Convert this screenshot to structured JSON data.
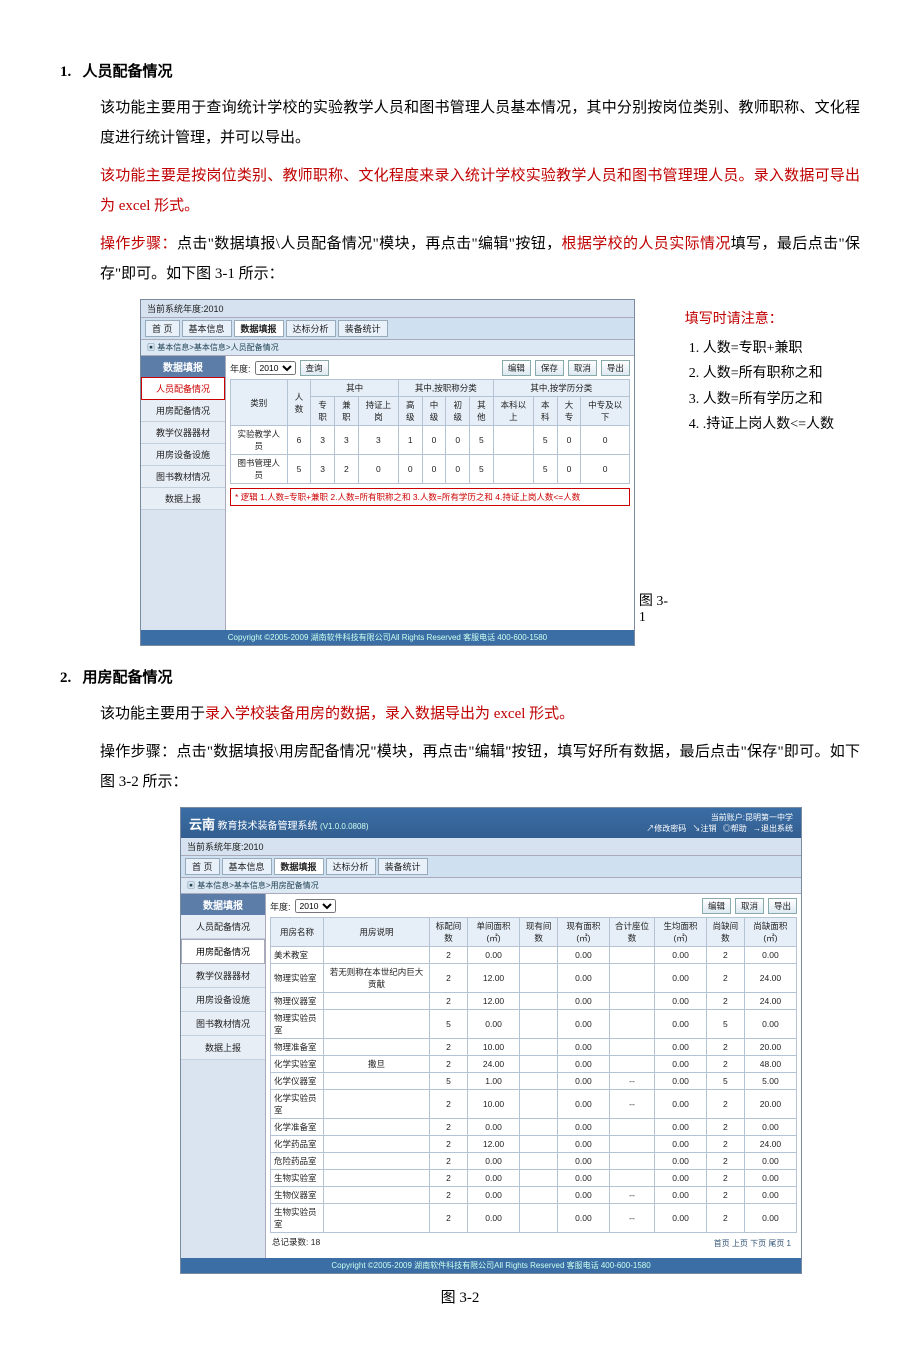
{
  "s1": {
    "num": "1.",
    "title": "人员配备情况",
    "p1a": "该功能主要用于查询统计学校的实验教学人员和图书管理人员基本情况，其中分别按岗位类别、教师职称、文化程度进行统计管理，并可以导出。",
    "p2_red": "该功能主要是按岗位类别、教师职称、文化程度来录入统计学校实验教学人员和图书管理理人员。录入数据可导出为 excel 形式。",
    "p3_pre_red": "操作步骤：",
    "p3_black": "点击\"数据填报\\人员配备情况\"模块，再点击\"编辑\"按钮，",
    "p3_red2": "根据学校的人员实际情况",
    "p3_after": "填写，最后点击\"保存\"即可。如下图 3-1 所示：",
    "fig_label": "图 3-1"
  },
  "app1": {
    "yearbar": "当前系统年度:2010",
    "tabs": [
      "首 页",
      "基本信息",
      "数据填报",
      "达标分析",
      "装备统计"
    ],
    "crumb": "▣ 基本信息>基本信息>人员配备情况",
    "side_title": "数据填报",
    "side_items": [
      "人员配备情况",
      "用房配备情况",
      "教学仪器器材",
      "用房设备设施",
      "图书教材情况",
      "数据上报"
    ],
    "side_sel_index": 0,
    "year_label": "年度:",
    "year_value": "2010",
    "btn_query": "查询",
    "btns_right": [
      "编辑",
      "保存",
      "取消",
      "导出"
    ],
    "table": {
      "header_top": [
        "类别",
        "人数",
        "其中",
        "其中,按职称分类",
        "其中,按学历分类"
      ],
      "header_sub": [
        "专职",
        "兼职",
        "持证上岗",
        "高级",
        "中级",
        "初级",
        "其他",
        "本科以上",
        "本科",
        "大专",
        "中专及以下"
      ],
      "rows": [
        {
          "c": "实验教学人员",
          "vals": [
            "6",
            "3",
            "3",
            "3",
            "1",
            "0",
            "0",
            "5",
            "",
            "5",
            "0",
            "",
            "0"
          ]
        },
        {
          "c": "图书管理人员",
          "vals": [
            "5",
            "3",
            "2",
            "0",
            "0",
            "0",
            "0",
            "5",
            "",
            "5",
            "0",
            "",
            "0"
          ]
        }
      ]
    },
    "logic": "* 逻辑   1.人数=专职+兼职   2.人数=所有职称之和   3.人数=所有学历之和   4.持证上岗人数<=人数",
    "footer": "Copyright ©2005-2009 湖南软件科技有限公司All Rights Reserved  客服电话 400-600-1580"
  },
  "callout": {
    "title": "填写时请注意：",
    "items": [
      "人数=专职+兼职",
      "人数=所有职称之和",
      "人数=所有学历之和",
      ".持证上岗人数<=人数"
    ]
  },
  "s2": {
    "num": "2.",
    "title": "用房配备情况",
    "p1_pre": "该功能主要用于",
    "p1_red": "录入学校装备用房的数据，录入数据导出为 excel 形式。",
    "p2": "操作步骤：点击\"数据填报\\用房配备情况\"模块，再点击\"编辑\"按钮，填写好所有数据，最后点击\"保存\"即可。如下图 3-2 所示：",
    "fig_label": "图 3-2"
  },
  "app2": {
    "banner_left": "云南",
    "banner_title": "教育技术装备管理系统",
    "banner_ver": "(V1.0.0.0808)",
    "banner_user": "当前账户:昆明第一中学",
    "banner_links": [
      "↗修改密码",
      "↘注销",
      "◎帮助",
      "→退出系统"
    ],
    "yearbar": "当前系统年度:2010",
    "tabs": [
      "首 页",
      "基本信息",
      "数据填报",
      "达标分析",
      "装备统计"
    ],
    "crumb": "▣ 基本信息>基本信息>用房配备情况",
    "side_title": "数据填报",
    "side_items": [
      "人员配备情况",
      "用房配备情况",
      "教学仪器器材",
      "用房设备设施",
      "图书教材情况",
      "数据上报"
    ],
    "side_sel_index": 1,
    "year_label": "年度:",
    "year_value": "2010",
    "btns_right": [
      "编辑",
      "取消",
      "导出"
    ],
    "cols": [
      "用房名称",
      "用房说明",
      "标配间数",
      "单间面积(㎡)",
      "现有间数",
      "现有面积(㎡)",
      "合计座位数",
      "生均面积(㎡)",
      "尚缺间数",
      "尚缺面积(㎡)"
    ],
    "rows": [
      {
        "c": [
          "美术教室",
          "",
          "2",
          "0.00",
          "",
          "0.00",
          "",
          "0.00",
          "2",
          "0.00"
        ]
      },
      {
        "c": [
          "物理实验室",
          "若无则称在本世纪内巨大贡献",
          "2",
          "12.00",
          "",
          "0.00",
          "",
          "0.00",
          "2",
          "24.00"
        ]
      },
      {
        "c": [
          "物理仪器室",
          "",
          "2",
          "12.00",
          "",
          "0.00",
          "",
          "0.00",
          "2",
          "24.00"
        ]
      },
      {
        "c": [
          "物理实验员室",
          "",
          "5",
          "0.00",
          "",
          "0.00",
          "",
          "0.00",
          "5",
          "0.00"
        ]
      },
      {
        "c": [
          "物理准备室",
          "",
          "2",
          "10.00",
          "",
          "0.00",
          "",
          "0.00",
          "2",
          "20.00"
        ]
      },
      {
        "c": [
          "化学实验室",
          "撒旦",
          "2",
          "24.00",
          "",
          "0.00",
          "",
          "0.00",
          "2",
          "48.00"
        ]
      },
      {
        "c": [
          "化学仪器室",
          "",
          "5",
          "1.00",
          "",
          "0.00",
          "--",
          "0.00",
          "5",
          "5.00"
        ]
      },
      {
        "c": [
          "化学实验员室",
          "",
          "2",
          "10.00",
          "",
          "0.00",
          "--",
          "0.00",
          "2",
          "20.00"
        ]
      },
      {
        "c": [
          "化学准备室",
          "",
          "2",
          "0.00",
          "",
          "0.00",
          "",
          "0.00",
          "2",
          "0.00"
        ]
      },
      {
        "c": [
          "化学药品室",
          "",
          "2",
          "12.00",
          "",
          "0.00",
          "",
          "0.00",
          "2",
          "24.00"
        ]
      },
      {
        "c": [
          "危险药品室",
          "",
          "2",
          "0.00",
          "",
          "0.00",
          "",
          "0.00",
          "2",
          "0.00"
        ]
      },
      {
        "c": [
          "生物实验室",
          "",
          "2",
          "0.00",
          "",
          "0.00",
          "",
          "0.00",
          "2",
          "0.00"
        ]
      },
      {
        "c": [
          "生物仪器室",
          "",
          "2",
          "0.00",
          "",
          "0.00",
          "--",
          "0.00",
          "2",
          "0.00"
        ]
      },
      {
        "c": [
          "生物实验员室",
          "",
          "2",
          "0.00",
          "",
          "0.00",
          "--",
          "0.00",
          "2",
          "0.00"
        ]
      }
    ],
    "total": "总记录数: 18",
    "pager": "首页 上页 下页 尾页  1",
    "footer": "Copyright ©2005-2009 湖南软件科技有限公司All Rights Reserved  客服电话 400-600-1580"
  }
}
